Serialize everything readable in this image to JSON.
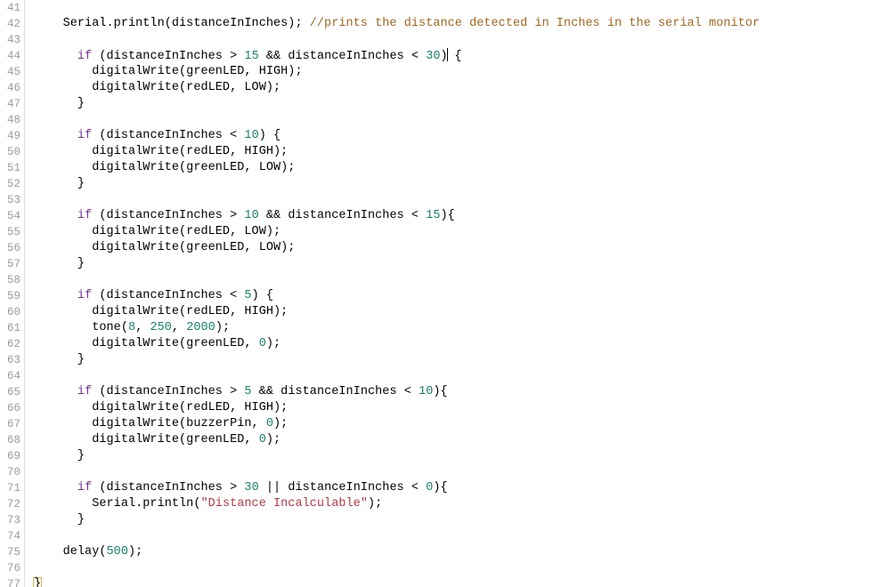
{
  "editor": {
    "name": "arduino-code-editor",
    "language": "arduino-cpp",
    "background_color": "#ffffff",
    "gutter_color": "#9a9a9a",
    "first_line_number": 41,
    "last_line_number": 77,
    "caret_line": 44,
    "syntax_colors": {
      "plain": "#000000",
      "keyword": "#7b2d8e",
      "number": "#1a7f6b",
      "comment": "#a0661e",
      "string": "#b03a48"
    }
  },
  "lines": [
    {
      "number": "41",
      "tokens": []
    },
    {
      "number": "42",
      "tokens": [
        {
          "t": "plain",
          "v": "    Serial.println(distanceInInches); "
        },
        {
          "t": "comment",
          "v": "//prints the distance detected in Inches in the serial monitor"
        }
      ]
    },
    {
      "number": "43",
      "tokens": []
    },
    {
      "number": "44",
      "tokens": [
        {
          "t": "plain",
          "v": "      "
        },
        {
          "t": "keyword",
          "v": "if"
        },
        {
          "t": "plain",
          "v": " (distanceInInches > "
        },
        {
          "t": "number",
          "v": "15"
        },
        {
          "t": "plain",
          "v": " && distanceInInches < "
        },
        {
          "t": "number",
          "v": "30"
        },
        {
          "t": "plain",
          "v": ")"
        },
        {
          "t": "caret",
          "v": ""
        },
        {
          "t": "plain",
          "v": " {"
        }
      ]
    },
    {
      "number": "45",
      "tokens": [
        {
          "t": "plain",
          "v": "        digitalWrite(greenLED, HIGH);"
        }
      ]
    },
    {
      "number": "46",
      "tokens": [
        {
          "t": "plain",
          "v": "        digitalWrite(redLED, LOW);"
        }
      ]
    },
    {
      "number": "47",
      "tokens": [
        {
          "t": "plain",
          "v": "      }"
        }
      ]
    },
    {
      "number": "48",
      "tokens": []
    },
    {
      "number": "49",
      "tokens": [
        {
          "t": "plain",
          "v": "      "
        },
        {
          "t": "keyword",
          "v": "if"
        },
        {
          "t": "plain",
          "v": " (distanceInInches < "
        },
        {
          "t": "number",
          "v": "10"
        },
        {
          "t": "plain",
          "v": ") {"
        }
      ]
    },
    {
      "number": "50",
      "tokens": [
        {
          "t": "plain",
          "v": "        digitalWrite(redLED, HIGH);"
        }
      ]
    },
    {
      "number": "51",
      "tokens": [
        {
          "t": "plain",
          "v": "        digitalWrite(greenLED, LOW);"
        }
      ]
    },
    {
      "number": "52",
      "tokens": [
        {
          "t": "plain",
          "v": "      }"
        }
      ]
    },
    {
      "number": "53",
      "tokens": []
    },
    {
      "number": "54",
      "tokens": [
        {
          "t": "plain",
          "v": "      "
        },
        {
          "t": "keyword",
          "v": "if"
        },
        {
          "t": "plain",
          "v": " (distanceInInches > "
        },
        {
          "t": "number",
          "v": "10"
        },
        {
          "t": "plain",
          "v": " && distanceInInches < "
        },
        {
          "t": "number",
          "v": "15"
        },
        {
          "t": "plain",
          "v": "){"
        }
      ]
    },
    {
      "number": "55",
      "tokens": [
        {
          "t": "plain",
          "v": "        digitalWrite(redLED, LOW);"
        }
      ]
    },
    {
      "number": "56",
      "tokens": [
        {
          "t": "plain",
          "v": "        digitalWrite(greenLED, LOW);"
        }
      ]
    },
    {
      "number": "57",
      "tokens": [
        {
          "t": "plain",
          "v": "      }"
        }
      ]
    },
    {
      "number": "58",
      "tokens": []
    },
    {
      "number": "59",
      "tokens": [
        {
          "t": "plain",
          "v": "      "
        },
        {
          "t": "keyword",
          "v": "if"
        },
        {
          "t": "plain",
          "v": " (distanceInInches < "
        },
        {
          "t": "number",
          "v": "5"
        },
        {
          "t": "plain",
          "v": ") {"
        }
      ]
    },
    {
      "number": "60",
      "tokens": [
        {
          "t": "plain",
          "v": "        digitalWrite(redLED, HIGH);"
        }
      ]
    },
    {
      "number": "61",
      "tokens": [
        {
          "t": "plain",
          "v": "        tone("
        },
        {
          "t": "number",
          "v": "8"
        },
        {
          "t": "plain",
          "v": ", "
        },
        {
          "t": "number",
          "v": "250"
        },
        {
          "t": "plain",
          "v": ", "
        },
        {
          "t": "number",
          "v": "2000"
        },
        {
          "t": "plain",
          "v": ");"
        }
      ]
    },
    {
      "number": "62",
      "tokens": [
        {
          "t": "plain",
          "v": "        digitalWrite(greenLED, "
        },
        {
          "t": "number",
          "v": "0"
        },
        {
          "t": "plain",
          "v": ");"
        }
      ]
    },
    {
      "number": "63",
      "tokens": [
        {
          "t": "plain",
          "v": "      }"
        }
      ]
    },
    {
      "number": "64",
      "tokens": []
    },
    {
      "number": "65",
      "tokens": [
        {
          "t": "plain",
          "v": "      "
        },
        {
          "t": "keyword",
          "v": "if"
        },
        {
          "t": "plain",
          "v": " (distanceInInches > "
        },
        {
          "t": "number",
          "v": "5"
        },
        {
          "t": "plain",
          "v": " && distanceInInches < "
        },
        {
          "t": "number",
          "v": "10"
        },
        {
          "t": "plain",
          "v": "){"
        }
      ]
    },
    {
      "number": "66",
      "tokens": [
        {
          "t": "plain",
          "v": "        digitalWrite(redLED, HIGH);"
        }
      ]
    },
    {
      "number": "67",
      "tokens": [
        {
          "t": "plain",
          "v": "        digitalWrite(buzzerPin, "
        },
        {
          "t": "number",
          "v": "0"
        },
        {
          "t": "plain",
          "v": ");"
        }
      ]
    },
    {
      "number": "68",
      "tokens": [
        {
          "t": "plain",
          "v": "        digitalWrite(greenLED, "
        },
        {
          "t": "number",
          "v": "0"
        },
        {
          "t": "plain",
          "v": ");"
        }
      ]
    },
    {
      "number": "69",
      "tokens": [
        {
          "t": "plain",
          "v": "      }"
        }
      ]
    },
    {
      "number": "70",
      "tokens": []
    },
    {
      "number": "71",
      "tokens": [
        {
          "t": "plain",
          "v": "      "
        },
        {
          "t": "keyword",
          "v": "if"
        },
        {
          "t": "plain",
          "v": " (distanceInInches > "
        },
        {
          "t": "number",
          "v": "30"
        },
        {
          "t": "plain",
          "v": " || distanceInInches < "
        },
        {
          "t": "number",
          "v": "0"
        },
        {
          "t": "plain",
          "v": "){"
        }
      ]
    },
    {
      "number": "72",
      "tokens": [
        {
          "t": "plain",
          "v": "        Serial.println("
        },
        {
          "t": "string",
          "v": "\"Distance Incalculable\""
        },
        {
          "t": "plain",
          "v": ");"
        }
      ]
    },
    {
      "number": "73",
      "tokens": [
        {
          "t": "plain",
          "v": "      }"
        }
      ]
    },
    {
      "number": "74",
      "tokens": []
    },
    {
      "number": "75",
      "tokens": [
        {
          "t": "plain",
          "v": "    delay("
        },
        {
          "t": "number",
          "v": "500"
        },
        {
          "t": "plain",
          "v": ");"
        }
      ]
    },
    {
      "number": "76",
      "tokens": []
    },
    {
      "number": "77",
      "tokens": [
        {
          "t": "brace-hl",
          "v": "}"
        }
      ]
    }
  ]
}
